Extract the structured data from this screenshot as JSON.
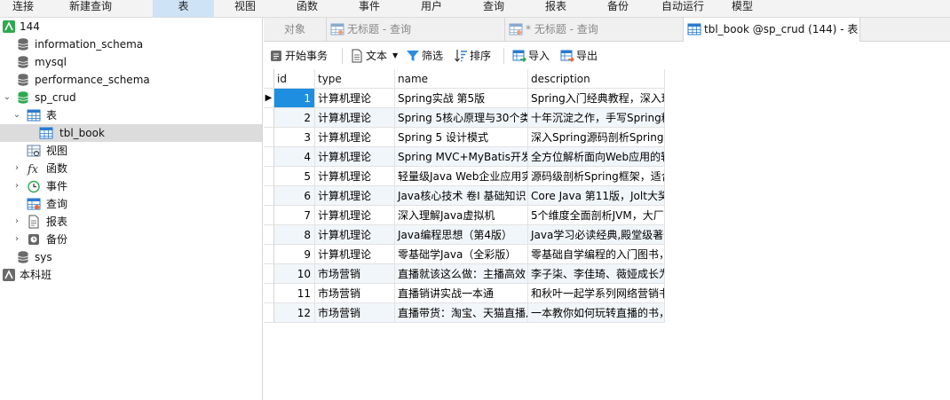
{
  "toolbar": {
    "items": [
      "连接",
      "新建查询",
      "表",
      "视图",
      "函数",
      "事件",
      "用户",
      "查询",
      "报表",
      "备份",
      "自动运行",
      "模型"
    ],
    "active_index": 2,
    "accent": "#cfe3f7"
  },
  "sidebar": {
    "connection": "144",
    "databases": [
      "information_schema",
      "mysql",
      "performance_schema",
      "sp_crud"
    ],
    "sp_crud_children": {
      "tables": "表",
      "selected_table": "tbl_book",
      "views": "视图",
      "functions": "函数",
      "events": "事件",
      "queries": "查询",
      "reports": "报表",
      "backups": "备份"
    },
    "sys": "sys",
    "other_connection": "本科班"
  },
  "tabs": {
    "objects": "对象",
    "query1": "无标题 - 查询",
    "query2": "* 无标题 - 查询",
    "active": "tbl_book @sp_crud (144) - 表"
  },
  "actions": {
    "begin_transaction": "开始事务",
    "text": "文本",
    "filter": "筛选",
    "sort": "排序",
    "import": "导入",
    "export": "导出"
  },
  "grid": {
    "columns": [
      "id",
      "type",
      "name",
      "description"
    ],
    "rows": [
      [
        "1",
        "计算机理论",
        "Spring实战 第5版",
        "Spring入门经典教程，深入理"
      ],
      [
        "2",
        "计算机理论",
        "Spring 5核心原理与30个类",
        "十年沉淀之作，手写Spring精"
      ],
      [
        "3",
        "计算机理论",
        "Spring 5 设计模式",
        "深入Spring源码剖析Spring源"
      ],
      [
        "4",
        "计算机理论",
        "Spring MVC+MyBatis开发",
        "全方位解析面向Web应用的轻"
      ],
      [
        "5",
        "计算机理论",
        "轻量级Java Web企业应用实",
        "源码级剖析Spring框架，适合"
      ],
      [
        "6",
        "计算机理论",
        "Java核心技术 卷I 基础知识",
        "Core Java 第11版，Jolt大奖"
      ],
      [
        "7",
        "计算机理论",
        "深入理解Java虚拟机",
        "5个维度全面剖析JVM，大厂面"
      ],
      [
        "8",
        "计算机理论",
        "Java编程思想（第4版）",
        "Java学习必读经典,殿堂级著作"
      ],
      [
        "9",
        "计算机理论",
        "零基础学Java（全彩版）",
        "零基础自学编程的入门图书，由"
      ],
      [
        "10",
        "市场营销",
        "直播就该这么做：主播高效",
        "李子柒、李佳琦、薇娅成长为网"
      ],
      [
        "11",
        "市场营销",
        "直播销讲实战一本通",
        "和秋叶一起学系列网络营销书"
      ],
      [
        "12",
        "市场营销",
        "直播带货：淘宝、天猫直播从",
        "一本教你如何玩转直播的书，1"
      ]
    ],
    "current_row_marker": "▶",
    "selected_color": "#1e8ee0"
  }
}
